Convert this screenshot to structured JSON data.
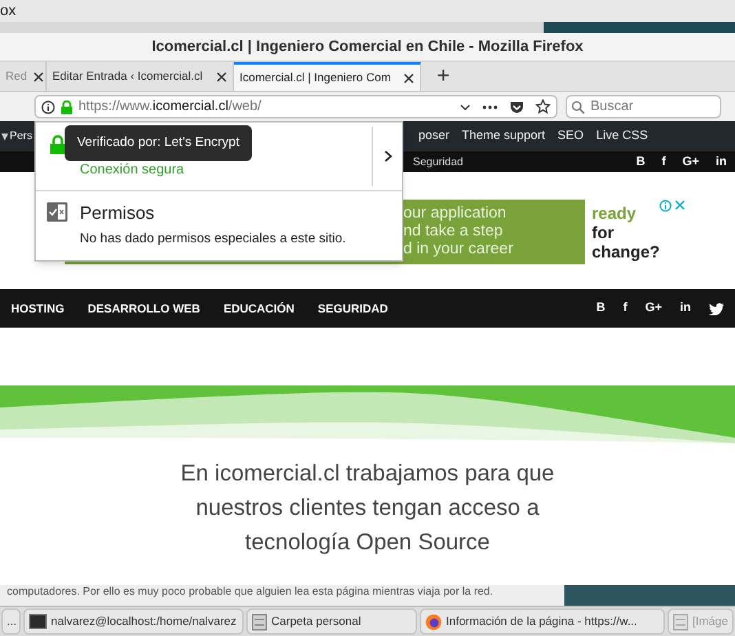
{
  "background_window": {
    "title": "ox"
  },
  "window": {
    "title": "Icomercial.cl | Ingeniero Comercial en Chile - Mozilla Firefox"
  },
  "tabs": [
    {
      "label": "Red",
      "selected": false
    },
    {
      "label": "Editar Entrada ‹ Icomercial.cl",
      "selected": false
    },
    {
      "label": "Icomercial.cl | Ingeniero Com",
      "selected": true
    }
  ],
  "new_tab": "+",
  "url_bar": {
    "prefix": "https://www.",
    "domain": "icomercial.cl",
    "path": "/web/"
  },
  "search": {
    "placeholder": "Buscar"
  },
  "site_info_popup": {
    "tooltip": "Verificado por: Let's Encrypt",
    "connection_status": "Conexión segura",
    "permissions_title": "Permisos",
    "permissions_text": "No has dado permisos especiales a este sitio."
  },
  "admin_bar": {
    "items": [
      "Pers",
      "poser",
      "Theme support",
      "SEO",
      "Live CSS"
    ]
  },
  "top_bar": {
    "items": [
      "Seguridad"
    ],
    "social": [
      "B",
      "f",
      "G+",
      "in"
    ]
  },
  "ad": {
    "lines": [
      "our application",
      "nd take a step",
      "d in your career"
    ],
    "side_lines": [
      "ready",
      "for",
      "change?"
    ]
  },
  "nav": {
    "items": [
      "HOSTING",
      "DESARROLLO WEB",
      "EDUCACIÓN",
      "SEGURIDAD"
    ],
    "social": [
      "B",
      "f",
      "G+",
      "in"
    ]
  },
  "hero": {
    "lines": [
      "En icomercial.cl trabajamos para que",
      "nuestros clientes tengan acceso a",
      "tecnología Open Source"
    ]
  },
  "background_dialog": {
    "text": "computadores. Por ello es muy poco probable que alguien lea esta página mientras viaja por la red."
  },
  "taskbar": {
    "items": [
      {
        "kind": "menu",
        "label": "..."
      },
      {
        "kind": "terminal",
        "label": "nalvarez@localhost:/home/nalvarez"
      },
      {
        "kind": "folder",
        "label": "Carpeta personal"
      },
      {
        "kind": "browser",
        "label": "Información de la página - https://w..."
      },
      {
        "kind": "image",
        "label": "[Imáge"
      }
    ]
  }
}
